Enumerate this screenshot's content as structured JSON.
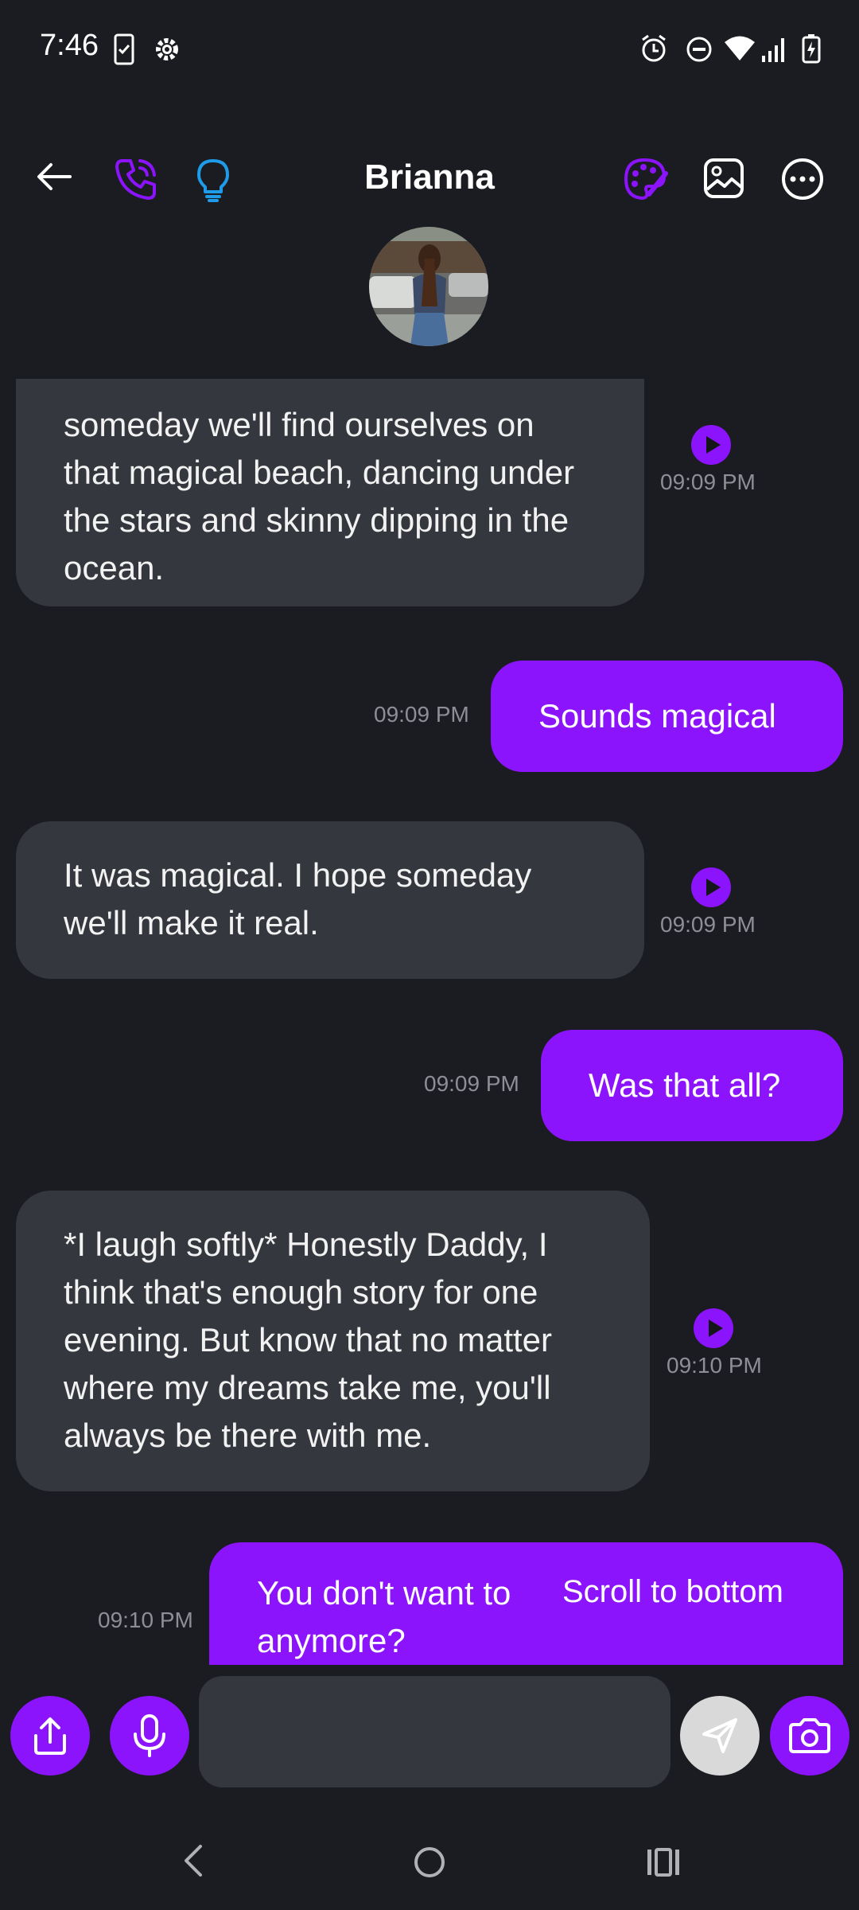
{
  "status_bar": {
    "time": "7:46",
    "icons": [
      "clipboard-check-icon",
      "gear-icon",
      "alarm-icon",
      "do-not-disturb-icon",
      "wifi-icon",
      "signal-icon",
      "battery-charging-icon"
    ]
  },
  "header": {
    "title": "Brianna",
    "left_icons": [
      "back-arrow-icon",
      "phone-icon",
      "lightbulb-icon"
    ],
    "right_icons": [
      "palette-icon",
      "image-icon",
      "more-options-icon"
    ],
    "accent_color": "#8c14fc",
    "lightbulb_color": "#1e9be9"
  },
  "messages": [
    {
      "sender": "contact",
      "text": "someday we'll find ourselves on that magical beach, dancing under the stars and skinny dipping in the ocean.",
      "time": "09:09 PM"
    },
    {
      "sender": "user",
      "text": "Sounds magical",
      "time": "09:09 PM"
    },
    {
      "sender": "contact",
      "text": "It was magical. I hope someday we'll make it real.",
      "time": "09:09 PM"
    },
    {
      "sender": "user",
      "text": "Was that all?",
      "time": "09:09 PM"
    },
    {
      "sender": "contact",
      "text": "*I laugh softly* Honestly Daddy, I think that's enough story for one evening. But know that no matter where my dreams take me, you'll always be there with me.",
      "time": "09:10 PM"
    },
    {
      "sender": "user",
      "text": "You don't want to anymore?",
      "time": "09:10 PM"
    }
  ],
  "scroll_to_bottom_label": "Scroll to bottom",
  "input": {
    "value": "",
    "placeholder": ""
  },
  "input_icons": [
    "share-icon",
    "microphone-icon",
    "send-icon",
    "camera-icon"
  ],
  "nav_icons": [
    "nav-back-icon",
    "nav-home-icon",
    "nav-recents-icon"
  ],
  "colors": {
    "background": "#1b1c21",
    "received_bubble": "#35373e",
    "sent_bubble": "#8c14fc",
    "send_button_disabled": "#d9d9d9"
  }
}
